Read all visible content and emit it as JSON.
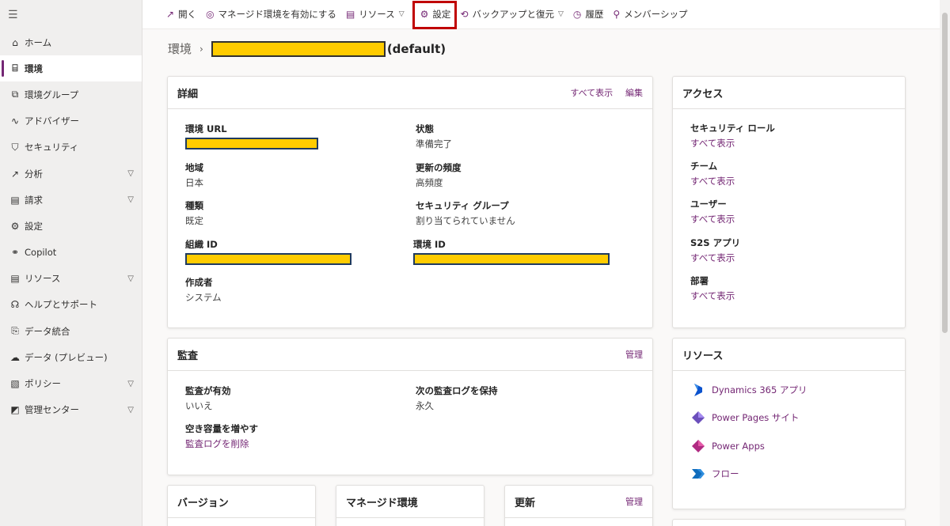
{
  "sidebar": {
    "menu_icon": "hamburger-icon",
    "items": [
      {
        "label": "ホーム",
        "icon": "home-icon"
      },
      {
        "label": "環境",
        "icon": "environment-icon",
        "active": true
      },
      {
        "label": "環境グループ",
        "icon": "environment-group-icon"
      },
      {
        "label": "アドバイザー",
        "icon": "advisor-icon"
      },
      {
        "label": "セキュリティ",
        "icon": "shield-icon"
      },
      {
        "label": "分析",
        "icon": "chart-icon",
        "expandable": true
      },
      {
        "label": "請求",
        "icon": "billing-icon",
        "expandable": true
      },
      {
        "label": "設定",
        "icon": "gear-icon"
      },
      {
        "label": "Copilot",
        "icon": "copilot-icon"
      },
      {
        "label": "リソース",
        "icon": "resources-icon",
        "expandable": true
      },
      {
        "label": "ヘルプとサポート",
        "icon": "headset-icon"
      },
      {
        "label": "データ統合",
        "icon": "data-integration-icon"
      },
      {
        "label": "データ (プレビュー)",
        "icon": "cloud-data-icon"
      },
      {
        "label": "ポリシー",
        "icon": "policy-icon",
        "expandable": true
      },
      {
        "label": "管理センター",
        "icon": "admin-center-icon",
        "expandable": true
      }
    ]
  },
  "toolbar": {
    "open": "開く",
    "enable_managed": "マネージド環境を有効にする",
    "resources": "リソース",
    "settings": "設定",
    "backup_restore": "バックアップと復元",
    "history": "履歴",
    "membership": "メンバーシップ"
  },
  "breadcrumb": {
    "root": "環境",
    "current_suffix": "(default)"
  },
  "details": {
    "title": "詳細",
    "show_all": "すべて表示",
    "edit": "編集",
    "env_url_label": "環境 URL",
    "state_label": "状態",
    "state_value": "準備完了",
    "region_label": "地域",
    "region_value": "日本",
    "update_freq_label": "更新の頻度",
    "update_freq_value": "高頻度",
    "type_label": "種類",
    "type_value": "既定",
    "security_group_label": "セキュリティ グループ",
    "security_group_value": "割り当てられていません",
    "org_id_label": "組織 ID",
    "env_id_label": "環境 ID",
    "created_by_label": "作成者",
    "created_by_value": "システム"
  },
  "audit": {
    "title": "監査",
    "manage": "管理",
    "enabled_label": "監査が有効",
    "enabled_value": "いいえ",
    "retain_label": "次の監査ログを保持",
    "retain_value": "永久",
    "free_space_label": "空き容量を増やす",
    "delete_logs": "監査ログを削除"
  },
  "bottom_cards": {
    "version_title": "バージョン",
    "managed_title": "マネージド環境",
    "updates_title": "更新",
    "updates_manage": "管理"
  },
  "access": {
    "title": "アクセス",
    "items": [
      {
        "label": "セキュリティ ロール",
        "link": "すべて表示"
      },
      {
        "label": "チーム",
        "link": "すべて表示"
      },
      {
        "label": "ユーザー",
        "link": "すべて表示"
      },
      {
        "label": "S2S アプリ",
        "link": "すべて表示"
      },
      {
        "label": "部署",
        "link": "すべて表示"
      }
    ]
  },
  "resources": {
    "title": "リソース",
    "items": [
      {
        "label": "Dynamics 365 アプリ",
        "icon": "dynamics365-icon",
        "color": "#0b53ce"
      },
      {
        "label": "Power Pages サイト",
        "icon": "power-pages-icon",
        "color": "#6b4fbb"
      },
      {
        "label": "Power Apps",
        "icon": "power-apps-icon",
        "color": "#b02b82"
      },
      {
        "label": "フロー",
        "icon": "power-automate-icon",
        "color": "#0f6cbd"
      }
    ]
  },
  "colors": {
    "accent": "#742774",
    "redaction": "#ffcc00",
    "highlight_box": "#c00000"
  }
}
